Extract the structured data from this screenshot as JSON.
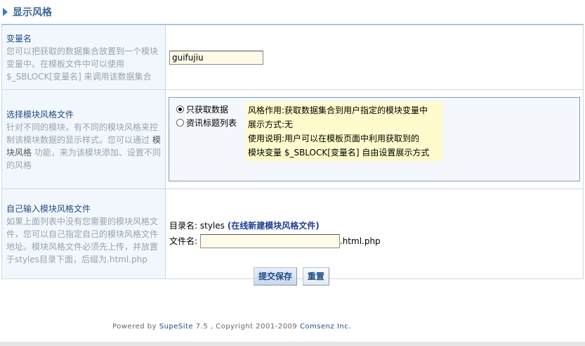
{
  "section": {
    "title": "显示风格"
  },
  "rows": {
    "variable": {
      "title": "变量名",
      "desc": "您可以把获取的数据集合放置到一个模块变量中。在模板文件中可以使用 $_SBLOCK[变量名] 来调用该数据集合",
      "value": "guifujiu"
    },
    "style": {
      "title": "选择模块风格文件",
      "desc_before": "针对不同的模块，有不同的模块风格来控制该模块数据的显示样式。您可以通过 ",
      "desc_keyword": "模块风格",
      "desc_after": " 功能，来为该模块添加、设置不同的风格",
      "options": [
        {
          "label": "只获取数据",
          "selected": true
        },
        {
          "label": "资讯标题列表",
          "selected": false
        }
      ],
      "tip": {
        "line1": "风格作用:获取数据集合到用户指定的模块变量中",
        "line2": "展示方式:无",
        "line3": "使用说明:用户可以在模板页面中利用获取到的",
        "line4": "模块变量 $_SBLOCK[变量名] 自由设置展示方式"
      }
    },
    "custom": {
      "title": "自己输入模块风格文件",
      "desc": "如果上面列表中没有您需要的模块风格文件，您可以自己指定自己的模块风格文件地址。模块风格文件必须先上传，并放置于styles目录下面，后缀为.html.php",
      "dir_label": "目录名: styles",
      "dir_link": "(在线新建模块风格文件)",
      "file_label": "文件名:",
      "file_value": "",
      "file_suffix": ".html.php"
    }
  },
  "buttons": {
    "submit": "提交保存",
    "reset": "重置"
  },
  "footer": {
    "prefix": "Powered by ",
    "product": "SupeSite",
    "version": " 7.5 , Copyright 2001-2009 ",
    "company": "Comsenz Inc."
  }
}
